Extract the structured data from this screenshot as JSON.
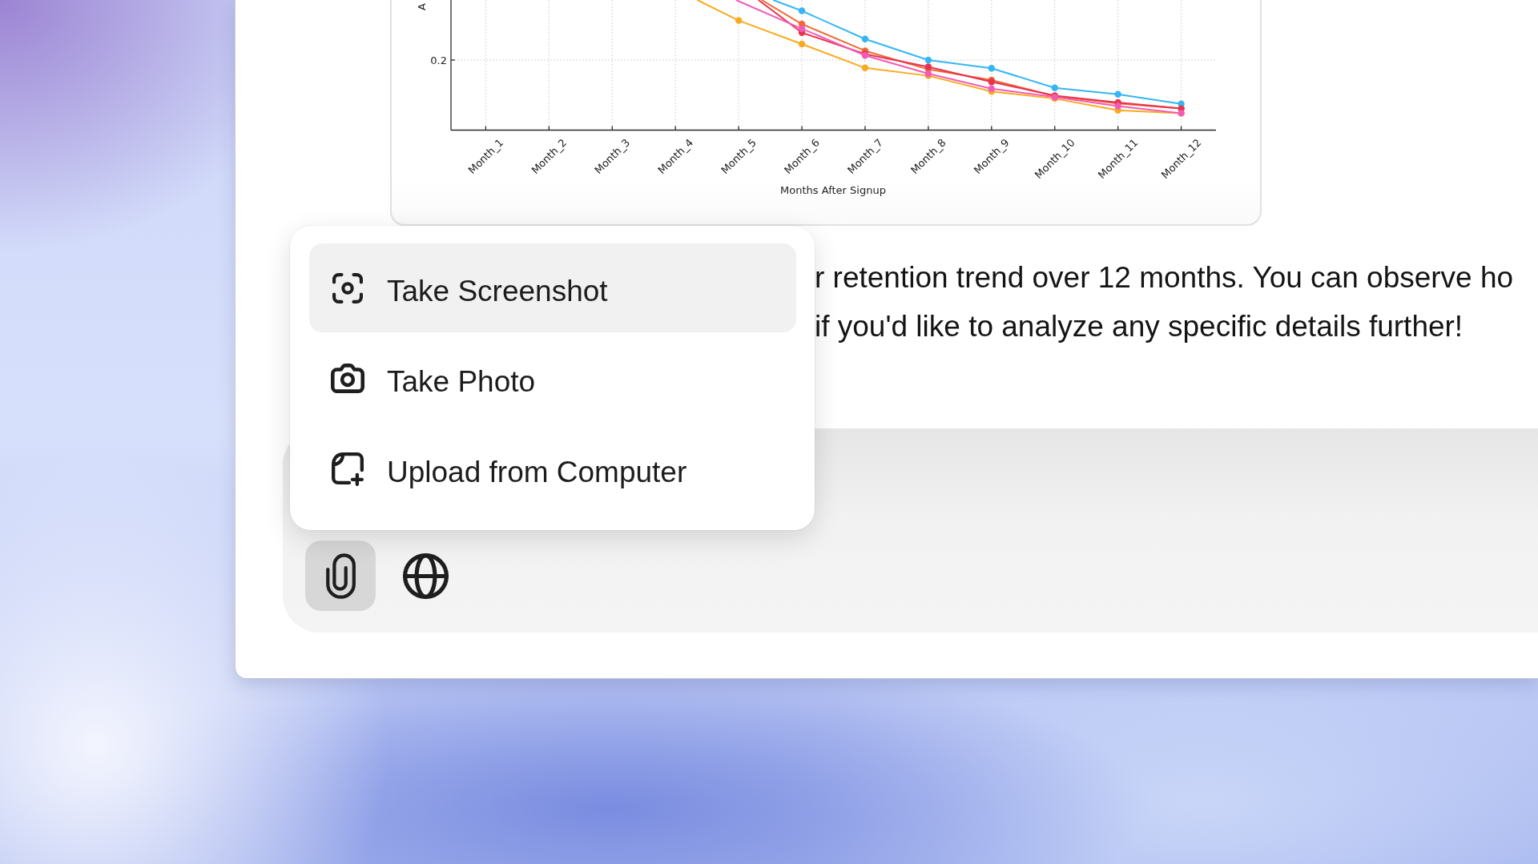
{
  "chart_card": {
    "y_axis_title": "A",
    "y_tick_label": "0.2",
    "x_tick_labels": [
      "Month_1",
      "Month_2",
      "Month_3",
      "Month_4",
      "Month_5",
      "Month_6",
      "Month_7",
      "Month_8",
      "Month_9",
      "Month_10",
      "Month_11",
      "Month_12"
    ],
    "x_axis_title": "Months After Signup"
  },
  "message": {
    "lines": [
      "r retention trend over 12 months. You can observe ho",
      "if you'd like to analyze any specific details further!"
    ]
  },
  "attach_menu": {
    "items": [
      {
        "kind": "screenshot",
        "label": "Take Screenshot",
        "selected": true
      },
      {
        "kind": "photo",
        "label": "Take Photo",
        "selected": false
      },
      {
        "kind": "upload",
        "label": "Upload from Computer",
        "selected": false
      }
    ]
  },
  "composer": {
    "buttons": [
      {
        "kind": "attach",
        "selected": true
      },
      {
        "kind": "web",
        "selected": false
      }
    ]
  }
}
